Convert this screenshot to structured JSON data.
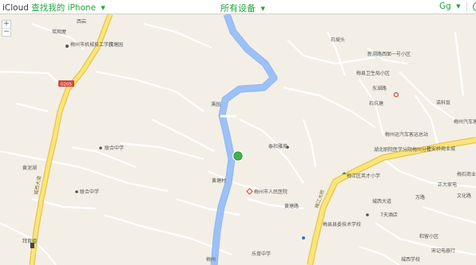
{
  "header": {
    "app_name": "iCloud",
    "app_section": "查找我的 iPhone",
    "device_selector": "所有设备",
    "user_initials": "Gg",
    "accent_color": "#1fa53c"
  },
  "map": {
    "zoom_in": "+",
    "zoom_out": "−",
    "labels": {
      "a1": "瑶观屋",
      "a2": "西岩",
      "a3": "梅州市机械技工学校",
      "a4": "茂塘园",
      "a5": "0205",
      "a6": "石坡头",
      "a7": "新溯路西面一号小区",
      "a8": "梅县卫生局小区",
      "a9": "溪园",
      "a10": "石坑塘",
      "a11": "诺科饭",
      "a12": "梅州汽车客运有限公司",
      "a13": "梅州运汽车客运总站",
      "a14": "湖北职院医学分院梅州分校",
      "a15": "平安桥商业城",
      "a16": "联合中学",
      "a17": "泰和雅苑",
      "a18": "黄泥湖",
      "a19": "黄塘村",
      "a20": "梅州市人民医院",
      "a21": "梅江区英才小学",
      "a22": "梅石商业街",
      "a23": "联合中学",
      "a24": "黄塘路",
      "a25": "城西大道",
      "a26": "梅江大桥",
      "a27": "7天酒店",
      "a28": "梅县县委技术学校",
      "a29": "和留小区",
      "a30": "宋记电器行",
      "a31": "乐育中学",
      "a32": "梅州",
      "a33": "拜育墟",
      "a34": "东湖路",
      "a35": "万路",
      "a36": "城西学校",
      "a37": "正大家电",
      "a38": "文化路"
    }
  }
}
